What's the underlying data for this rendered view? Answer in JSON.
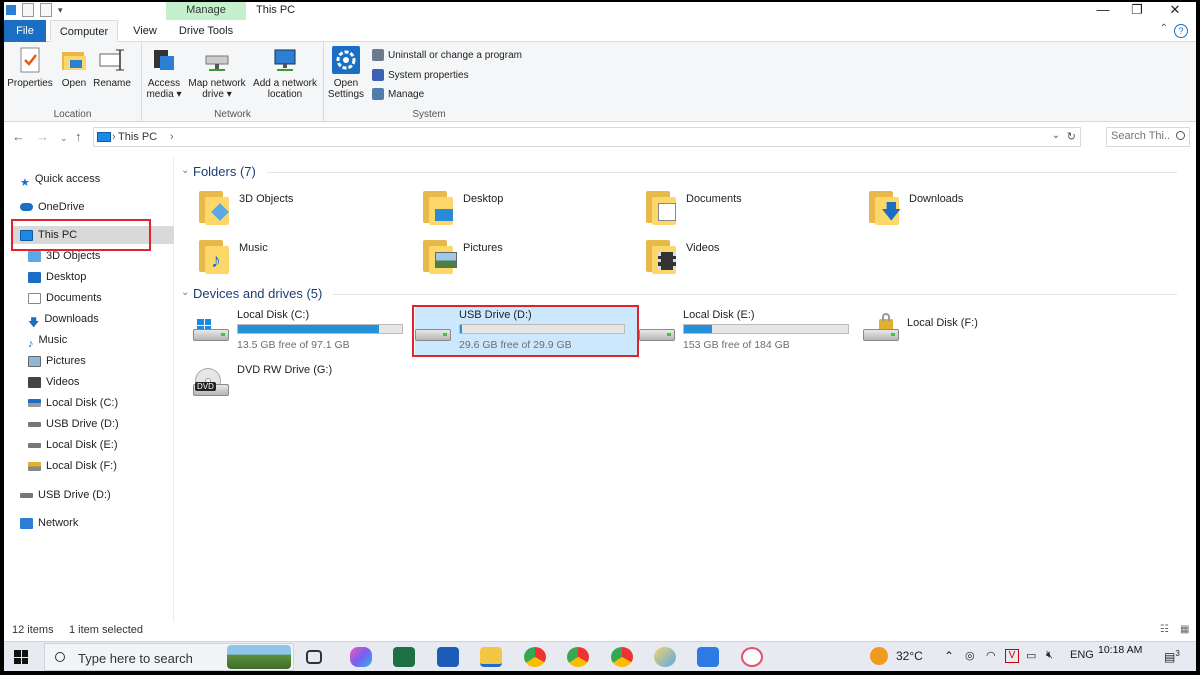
{
  "window": {
    "title": "This PC",
    "context_tab_group": "Manage",
    "minimize_glyph": "—",
    "restore_glyph": "❐",
    "close_glyph": "✕"
  },
  "ribbon_tabs": [
    "File",
    "Computer",
    "View",
    "Drive Tools"
  ],
  "ribbon": {
    "location": {
      "label": "Location",
      "properties": "Properties",
      "open": "Open",
      "rename": "Rename"
    },
    "network": {
      "label": "Network",
      "access_media_1": "Access",
      "access_media_2": "media ▾",
      "map_drive_1": "Map network",
      "map_drive_2": "drive ▾",
      "add_location_1": "Add a network",
      "add_location_2": "location"
    },
    "system": {
      "label": "System",
      "open_settings_1": "Open",
      "open_settings_2": "Settings",
      "uninstall": "Uninstall or change a program",
      "system_properties": "System properties",
      "manage": "Manage"
    }
  },
  "address": {
    "crumb": "This PC",
    "sep": "›",
    "search_placeholder": "Search Thi..."
  },
  "nav_pane": {
    "quick_access": "Quick access",
    "onedrive": "OneDrive",
    "this_pc": "This PC",
    "children": [
      "3D Objects",
      "Desktop",
      "Documents",
      "Downloads",
      "Music",
      "Pictures",
      "Videos",
      "Local Disk (C:)",
      "USB Drive (D:)",
      "Local Disk (E:)",
      "Local Disk (F:)"
    ],
    "usb_drive": "USB Drive (D:)",
    "network": "Network"
  },
  "folders": {
    "heading": "Folders (7)",
    "items": [
      "3D Objects",
      "Desktop",
      "Documents",
      "Downloads",
      "Music",
      "Pictures",
      "Videos"
    ]
  },
  "drives": {
    "heading": "Devices and drives (5)",
    "items": [
      {
        "name": "Local Disk (C:)",
        "free": "13.5 GB free of 97.1 GB",
        "used_fraction": 0.86
      },
      {
        "name": "USB Drive (D:)",
        "free": "29.6 GB free of 29.9 GB",
        "used_fraction": 0.01
      },
      {
        "name": "Local Disk (E:)",
        "free": "153 GB free of 184 GB",
        "used_fraction": 0.17
      },
      {
        "name": "Local Disk (F:)"
      },
      {
        "name": "DVD RW Drive (G:)",
        "badge": "DVD"
      }
    ]
  },
  "status": {
    "items": "12 items",
    "selected": "1 item selected"
  },
  "taskbar": {
    "search_text": "Type here to search",
    "weather": "32°C",
    "language": "ENG",
    "time": "10:18 AM",
    "notifications": "3"
  }
}
